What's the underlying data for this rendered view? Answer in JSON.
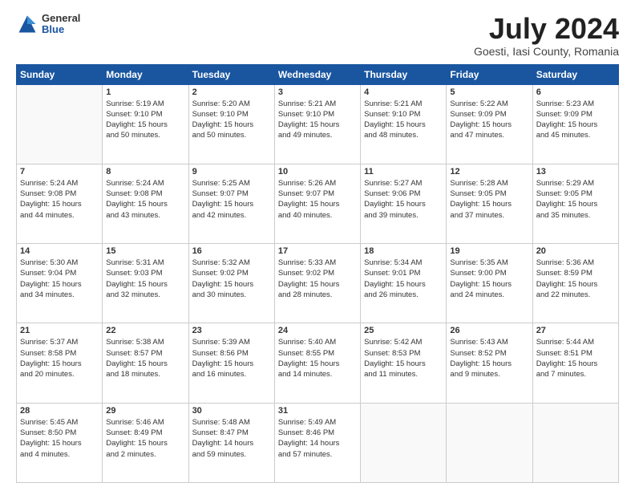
{
  "logo": {
    "general": "General",
    "blue": "Blue"
  },
  "title": "July 2024",
  "subtitle": "Goesti, Iasi County, Romania",
  "days_of_week": [
    "Sunday",
    "Monday",
    "Tuesday",
    "Wednesday",
    "Thursday",
    "Friday",
    "Saturday"
  ],
  "weeks": [
    [
      {
        "day": "",
        "info": ""
      },
      {
        "day": "1",
        "info": "Sunrise: 5:19 AM\nSunset: 9:10 PM\nDaylight: 15 hours\nand 50 minutes."
      },
      {
        "day": "2",
        "info": "Sunrise: 5:20 AM\nSunset: 9:10 PM\nDaylight: 15 hours\nand 50 minutes."
      },
      {
        "day": "3",
        "info": "Sunrise: 5:21 AM\nSunset: 9:10 PM\nDaylight: 15 hours\nand 49 minutes."
      },
      {
        "day": "4",
        "info": "Sunrise: 5:21 AM\nSunset: 9:10 PM\nDaylight: 15 hours\nand 48 minutes."
      },
      {
        "day": "5",
        "info": "Sunrise: 5:22 AM\nSunset: 9:09 PM\nDaylight: 15 hours\nand 47 minutes."
      },
      {
        "day": "6",
        "info": "Sunrise: 5:23 AM\nSunset: 9:09 PM\nDaylight: 15 hours\nand 45 minutes."
      }
    ],
    [
      {
        "day": "7",
        "info": "Sunrise: 5:24 AM\nSunset: 9:08 PM\nDaylight: 15 hours\nand 44 minutes."
      },
      {
        "day": "8",
        "info": "Sunrise: 5:24 AM\nSunset: 9:08 PM\nDaylight: 15 hours\nand 43 minutes."
      },
      {
        "day": "9",
        "info": "Sunrise: 5:25 AM\nSunset: 9:07 PM\nDaylight: 15 hours\nand 42 minutes."
      },
      {
        "day": "10",
        "info": "Sunrise: 5:26 AM\nSunset: 9:07 PM\nDaylight: 15 hours\nand 40 minutes."
      },
      {
        "day": "11",
        "info": "Sunrise: 5:27 AM\nSunset: 9:06 PM\nDaylight: 15 hours\nand 39 minutes."
      },
      {
        "day": "12",
        "info": "Sunrise: 5:28 AM\nSunset: 9:05 PM\nDaylight: 15 hours\nand 37 minutes."
      },
      {
        "day": "13",
        "info": "Sunrise: 5:29 AM\nSunset: 9:05 PM\nDaylight: 15 hours\nand 35 minutes."
      }
    ],
    [
      {
        "day": "14",
        "info": "Sunrise: 5:30 AM\nSunset: 9:04 PM\nDaylight: 15 hours\nand 34 minutes."
      },
      {
        "day": "15",
        "info": "Sunrise: 5:31 AM\nSunset: 9:03 PM\nDaylight: 15 hours\nand 32 minutes."
      },
      {
        "day": "16",
        "info": "Sunrise: 5:32 AM\nSunset: 9:02 PM\nDaylight: 15 hours\nand 30 minutes."
      },
      {
        "day": "17",
        "info": "Sunrise: 5:33 AM\nSunset: 9:02 PM\nDaylight: 15 hours\nand 28 minutes."
      },
      {
        "day": "18",
        "info": "Sunrise: 5:34 AM\nSunset: 9:01 PM\nDaylight: 15 hours\nand 26 minutes."
      },
      {
        "day": "19",
        "info": "Sunrise: 5:35 AM\nSunset: 9:00 PM\nDaylight: 15 hours\nand 24 minutes."
      },
      {
        "day": "20",
        "info": "Sunrise: 5:36 AM\nSunset: 8:59 PM\nDaylight: 15 hours\nand 22 minutes."
      }
    ],
    [
      {
        "day": "21",
        "info": "Sunrise: 5:37 AM\nSunset: 8:58 PM\nDaylight: 15 hours\nand 20 minutes."
      },
      {
        "day": "22",
        "info": "Sunrise: 5:38 AM\nSunset: 8:57 PM\nDaylight: 15 hours\nand 18 minutes."
      },
      {
        "day": "23",
        "info": "Sunrise: 5:39 AM\nSunset: 8:56 PM\nDaylight: 15 hours\nand 16 minutes."
      },
      {
        "day": "24",
        "info": "Sunrise: 5:40 AM\nSunset: 8:55 PM\nDaylight: 15 hours\nand 14 minutes."
      },
      {
        "day": "25",
        "info": "Sunrise: 5:42 AM\nSunset: 8:53 PM\nDaylight: 15 hours\nand 11 minutes."
      },
      {
        "day": "26",
        "info": "Sunrise: 5:43 AM\nSunset: 8:52 PM\nDaylight: 15 hours\nand 9 minutes."
      },
      {
        "day": "27",
        "info": "Sunrise: 5:44 AM\nSunset: 8:51 PM\nDaylight: 15 hours\nand 7 minutes."
      }
    ],
    [
      {
        "day": "28",
        "info": "Sunrise: 5:45 AM\nSunset: 8:50 PM\nDaylight: 15 hours\nand 4 minutes."
      },
      {
        "day": "29",
        "info": "Sunrise: 5:46 AM\nSunset: 8:49 PM\nDaylight: 15 hours\nand 2 minutes."
      },
      {
        "day": "30",
        "info": "Sunrise: 5:48 AM\nSunset: 8:47 PM\nDaylight: 14 hours\nand 59 minutes."
      },
      {
        "day": "31",
        "info": "Sunrise: 5:49 AM\nSunset: 8:46 PM\nDaylight: 14 hours\nand 57 minutes."
      },
      {
        "day": "",
        "info": ""
      },
      {
        "day": "",
        "info": ""
      },
      {
        "day": "",
        "info": ""
      }
    ]
  ]
}
